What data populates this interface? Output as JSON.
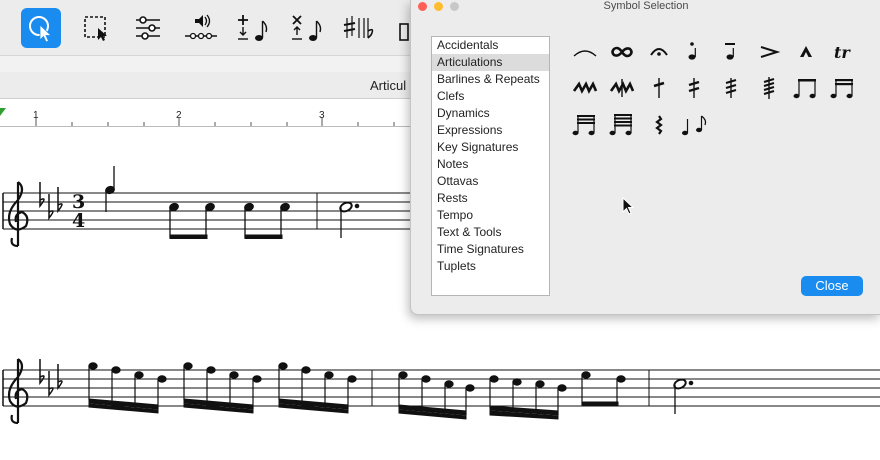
{
  "toolbar": {
    "tools": [
      {
        "name": "select-tool",
        "icon": "pointer-icon",
        "active": true
      },
      {
        "name": "marquee-tool",
        "icon": "marquee-select-icon",
        "active": false
      },
      {
        "name": "mixer-tool",
        "icon": "sliders-icon",
        "active": false
      },
      {
        "name": "playback-tool",
        "icon": "speaker-playback-icon",
        "active": false
      },
      {
        "name": "add-note-tool",
        "icon": "add-note-icon",
        "active": false
      },
      {
        "name": "delete-note-tool",
        "icon": "delete-note-icon",
        "active": false
      },
      {
        "name": "accidentals-tool",
        "icon": "accidentals-icon",
        "active": false
      }
    ]
  },
  "subbar": {
    "label": "Articul"
  },
  "ruler": {
    "marks": [
      "1",
      "2",
      "3"
    ]
  },
  "score": {
    "time_signature": {
      "top": "3",
      "bottom": "4"
    }
  },
  "dialog": {
    "title": "Symbol Selection",
    "categories": [
      "Accidentals",
      "Articulations",
      "Barlines & Repeats",
      "Clefs",
      "Dynamics",
      "Expressions",
      "Key Signatures",
      "Notes",
      "Ottavas",
      "Rests",
      "Tempo",
      "Text & Tools",
      "Time Signatures",
      "Tuplets"
    ],
    "selected_category": "Articulations",
    "symbols": [
      "slur-icon",
      "turn-icon",
      "fermata-icon",
      "staccato-icon",
      "tenuto-icon",
      "accent-icon",
      "marcato-icon",
      "trill-icon",
      "mordent-icon",
      "inverted-mordent-icon",
      "tremolo-1-icon",
      "tremolo-2-icon",
      "tremolo-3-icon",
      "tremolo-4-icon",
      "beamed-eighths-icon",
      "beamed-sixteenths-icon",
      "beamed-32nds-icon",
      "beamed-64ths-icon",
      "arpeggio-icon",
      "swing-icon"
    ],
    "trill_text": "tr",
    "close_label": "Close",
    "accent_color": "#1a8cf0"
  }
}
